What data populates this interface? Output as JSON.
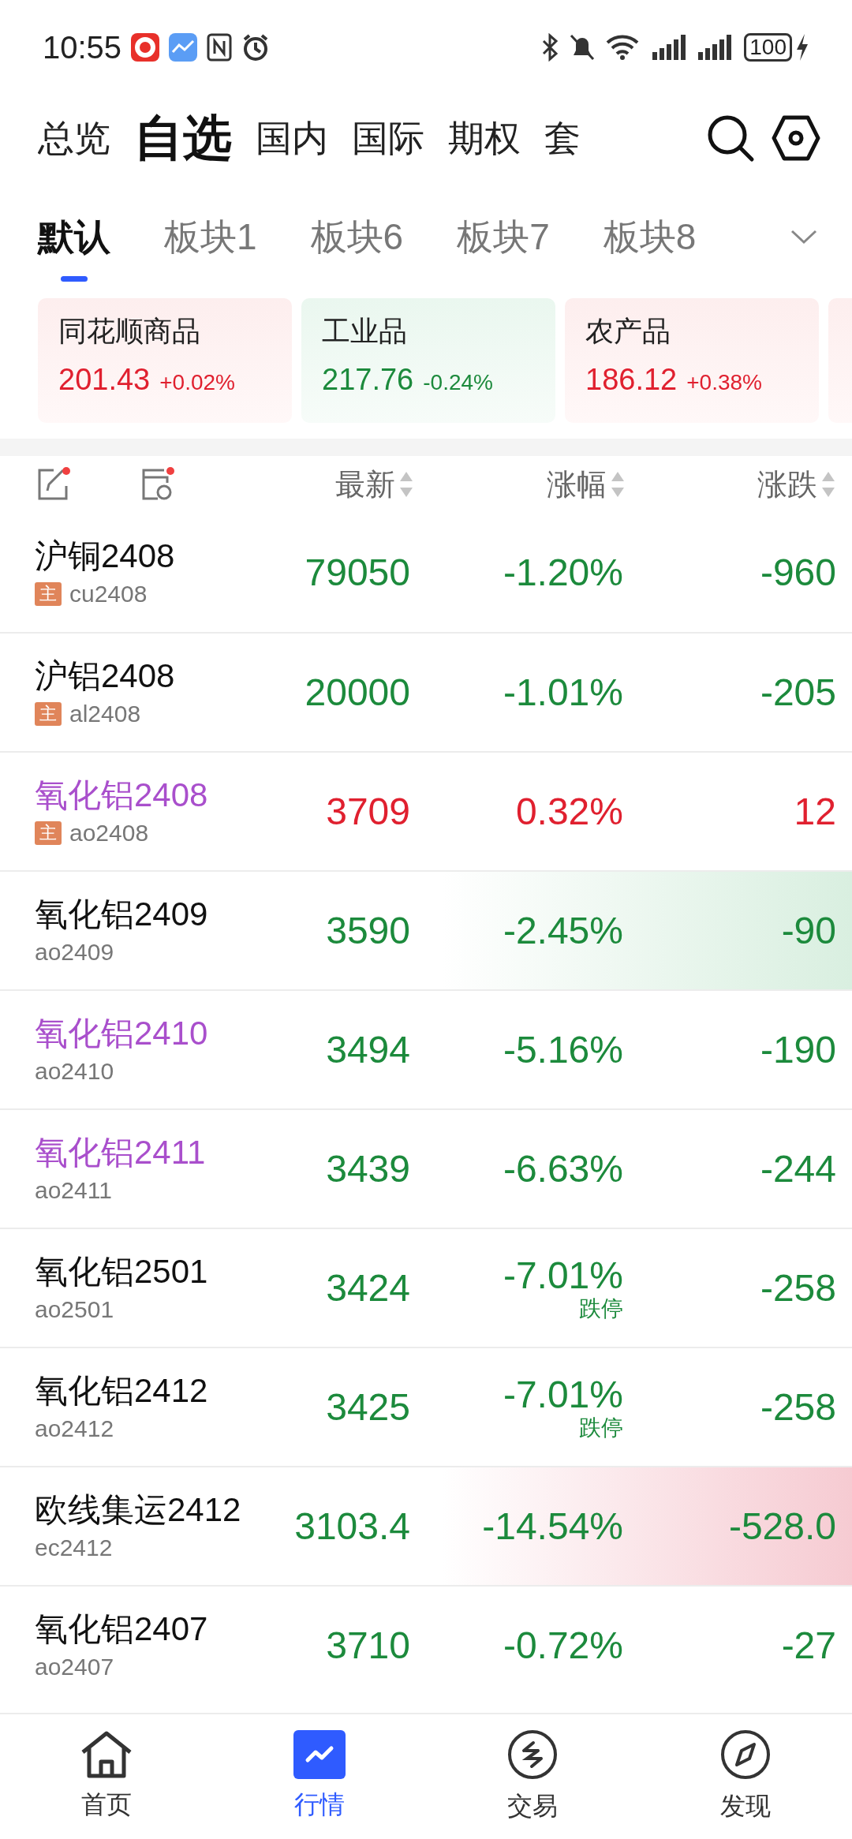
{
  "status_bar": {
    "time": "10:55",
    "battery": "100"
  },
  "top_tabs": [
    {
      "label": "总览",
      "selected": false
    },
    {
      "label": "自选",
      "selected": true
    },
    {
      "label": "国内",
      "selected": false
    },
    {
      "label": "国际",
      "selected": false
    },
    {
      "label": "期权",
      "selected": false
    },
    {
      "label": "套",
      "selected": false
    }
  ],
  "sub_tabs": [
    {
      "label": "默认",
      "selected": true
    },
    {
      "label": "板块1",
      "selected": false
    },
    {
      "label": "板块6",
      "selected": false
    },
    {
      "label": "板块7",
      "selected": false
    },
    {
      "label": "板块8",
      "selected": false
    }
  ],
  "index_cards": [
    {
      "name": "同花顺商品",
      "value": "201.43",
      "change": "+0.02%",
      "kind": "up"
    },
    {
      "name": "工业品",
      "value": "217.76",
      "change": "-0.24%",
      "kind": "down"
    },
    {
      "name": "农产品",
      "value": "186.12",
      "change": "+0.38%",
      "kind": "up"
    },
    {
      "kind": "up"
    }
  ],
  "table": {
    "columns": [
      "最新",
      "涨幅",
      "涨跌"
    ],
    "rows": [
      {
        "name": "沪铜2408",
        "color": "#111111",
        "tag": "主",
        "code": "cu2408",
        "price": "79050",
        "pct": "-1.20%",
        "change": "-960",
        "kind": "down"
      },
      {
        "name": "沪铝2408",
        "color": "#111111",
        "tag": "主",
        "code": "al2408",
        "price": "20000",
        "pct": "-1.01%",
        "change": "-205",
        "kind": "down"
      },
      {
        "name": "氧化铝2408",
        "color": "#a94fcc",
        "tag": "主",
        "code": "ao2408",
        "price": "3709",
        "pct": "0.32%",
        "change": "12",
        "kind": "up"
      },
      {
        "name": "氧化铝2409",
        "color": "#111111",
        "code": "ao2409",
        "price": "3590",
        "pct": "-2.45%",
        "change": "-90",
        "kind": "down",
        "highlight": {
          "kind": "green"
        }
      },
      {
        "name": "氧化铝2410",
        "color": "#a94fcc",
        "code": "ao2410",
        "price": "3494",
        "pct": "-5.16%",
        "change": "-190",
        "kind": "down"
      },
      {
        "name": "氧化铝2411",
        "color": "#a94fcc",
        "code": "ao2411",
        "price": "3439",
        "pct": "-6.63%",
        "change": "-244",
        "kind": "down"
      },
      {
        "name": "氧化铝2501",
        "color": "#111111",
        "code": "ao2501",
        "price": "3424",
        "pct": "-7.01%",
        "limit": "跌停",
        "change": "-258",
        "kind": "down"
      },
      {
        "name": "氧化铝2412",
        "color": "#111111",
        "code": "ao2412",
        "price": "3425",
        "pct": "-7.01%",
        "limit": "跌停",
        "change": "-258",
        "kind": "down"
      },
      {
        "name": "欧线集运2412",
        "color": "#111111",
        "code": "ec2412",
        "price": "3103.4",
        "pct": "-14.54%",
        "change": "-528.0",
        "kind": "down",
        "highlight": {
          "kind": "red"
        }
      },
      {
        "name": "氧化铝2407",
        "color": "#111111",
        "code": "ao2407",
        "price": "3710",
        "pct": "-0.72%",
        "change": "-27",
        "kind": "down"
      }
    ]
  },
  "bottom_nav": [
    {
      "label": "首页",
      "selected": false
    },
    {
      "label": "行情",
      "selected": true
    },
    {
      "label": "交易",
      "selected": false
    },
    {
      "label": "发现",
      "selected": false
    }
  ]
}
